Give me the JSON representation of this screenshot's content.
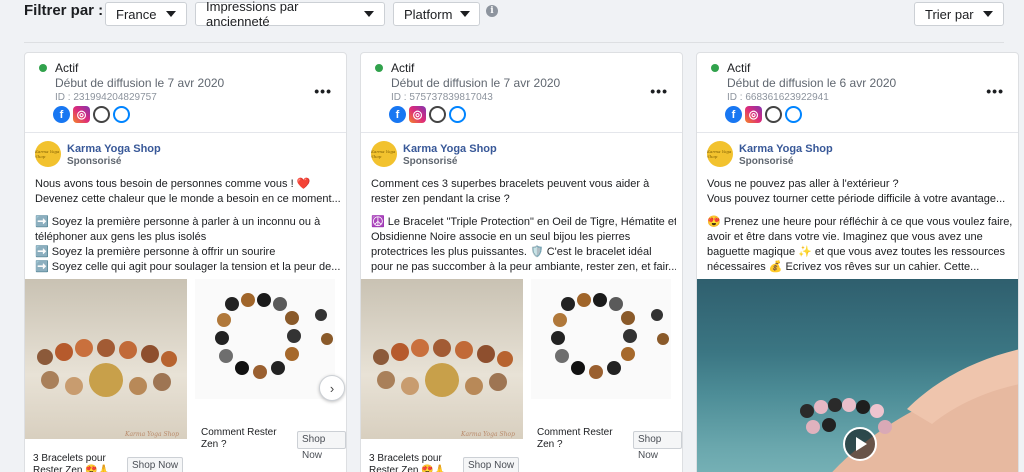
{
  "filters": {
    "label": "Filtrer par :",
    "country": "France",
    "impressions": "Impressions par ancienneté",
    "platform": "Platform",
    "sort": "Trier par"
  },
  "cards": [
    {
      "status": "Actif",
      "date": "Début de diffusion le 7 avr 2020",
      "id": "ID : 231994204829757",
      "page_name": "Karma Yoga Shop",
      "sponsored": "Sponsorisé",
      "avatar_text": "Karma Yoga Shop",
      "body": [
        "Nous avons tous besoin de personnes comme vous ! ❤️",
        "Devenez cette chaleur que le monde a besoin en ce moment...",
        "",
        "➡️  Soyez la première personne à parler à un inconnu ou à",
        "téléphoner aux gens les plus isolés",
        "➡️  Soyez la première personne à offrir un sourire",
        "➡️  Soyez celle qui agit pour soulager la tension et la peur de..."
      ],
      "caption1": "3 Bracelets pour Rester Zen 😍🙏",
      "shop1": "Shop Now",
      "caption2": "Comment Rester Zen ?",
      "shop2": "Shop Now",
      "watermark": "Karma Yoga Shop"
    },
    {
      "status": "Actif",
      "date": "Début de diffusion le 7 avr 2020",
      "id": "ID : 575737839817043",
      "page_name": "Karma Yoga Shop",
      "sponsored": "Sponsorisé",
      "avatar_text": "Karma Yoga Shop",
      "body": [
        "Comment ces 3 superbes bracelets peuvent vous aider à",
        "rester zen pendant la crise ?",
        "",
        "☮️ Le Bracelet \"Triple Protection\" en Oeil de Tigre, Hématite et",
        "Obsidienne Noire associe en un seul bijou les pierres",
        "protectrices les plus puissantes. 🛡️  C'est le bracelet idéal",
        "pour ne pas succomber à la peur ambiante, rester zen, et fair..."
      ],
      "caption1": "3 Bracelets pour Rester Zen 😍🙏",
      "shop1": "Shop Now",
      "caption2": "Comment Rester Zen ?",
      "shop2": "Shop Now",
      "watermark": "Karma Yoga Shop"
    },
    {
      "status": "Actif",
      "date": "Début de diffusion le 6 avr 2020",
      "id": "ID : 668361623922941",
      "page_name": "Karma Yoga Shop",
      "sponsored": "Sponsorisé",
      "avatar_text": "Karma Yoga Shop",
      "body": [
        "Vous ne pouvez pas aller à l'extérieur ?",
        "Vous pouvez tourner cette période difficile à votre avantage...",
        "",
        "😍  Prenez une heure pour réfléchir à ce que vous voulez faire,",
        "avoir et être dans votre vie. Imaginez que vous avez une",
        "baguette magique ✨  et que vous avez toutes les ressources",
        "nécessaires 💰  Ecrivez vos rêves sur un cahier. Cette..."
      ]
    }
  ],
  "icons": [
    "facebook-icon",
    "instagram-icon",
    "audience-network-icon",
    "messenger-icon",
    "info-icon",
    "more-icon",
    "chevron-right-icon",
    "play-icon"
  ],
  "colors": {
    "active": "#31a24c",
    "page_link": "#385898",
    "facebook": "#1877f2"
  }
}
